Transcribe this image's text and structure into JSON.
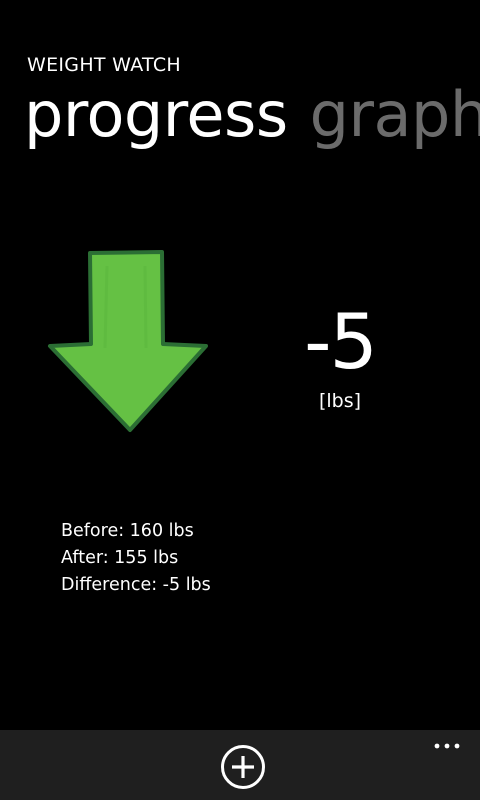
{
  "app": {
    "title": "WEIGHT WATCH",
    "accent_color": "#65c144"
  },
  "pivot": {
    "headers": [
      {
        "label": "progress",
        "active": true
      },
      {
        "label": "graph",
        "active": false
      }
    ]
  },
  "progress": {
    "trend_icon": "arrow-down-icon",
    "change_value": "-5",
    "change_unit": "[lbs]",
    "summary": {
      "before": "Before: 160 lbs",
      "after": "After: 155 lbs",
      "difference": "Difference: -5 lbs"
    }
  },
  "app_bar": {
    "background": "#1f1f1f",
    "add_icon": "add-circle-icon",
    "more_icon": "more-ellipsis-icon"
  }
}
